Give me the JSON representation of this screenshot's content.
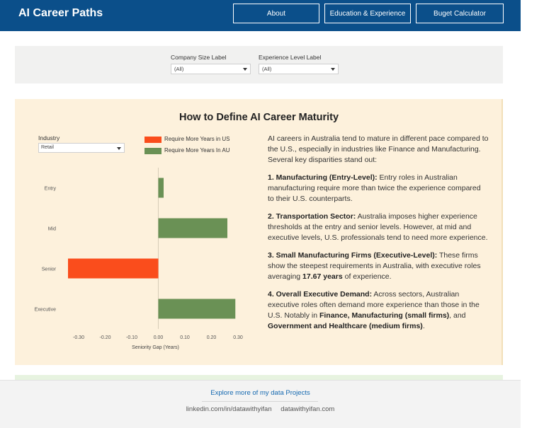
{
  "header": {
    "brand": "AI Career Paths",
    "nav": [
      "About",
      "Education & Experience",
      "Buget Calculator"
    ]
  },
  "filters": {
    "company_size": {
      "label": "Company Size Label",
      "value": "(All)"
    },
    "experience_level": {
      "label": "Experience Level Label",
      "value": "(All)"
    }
  },
  "panel": {
    "title": "How to Define AI Career Maturity",
    "industry": {
      "label": "Industry",
      "value": "Retail"
    },
    "legend": [
      {
        "label": "Require More Years in US",
        "color": "#fa4d1c"
      },
      {
        "label": "Require More Years In AU",
        "color": "#6a9155"
      }
    ],
    "intro": "AI careers in Australia tend to mature in different pace compared to the U.S., especially in industries like Finance and Manufacturing. Several key disparities stand out:",
    "points": [
      {
        "head": "1. Manufacturing (Entry-Level):",
        "body": " Entry roles in Australian manufacturing require more than twice the experience compared to their U.S. counterparts."
      },
      {
        "head": "2. Transportation Sector:",
        "body": " Australia imposes higher experience thresholds at the entry and senior levels. However, at mid and executive levels, U.S. professionals tend to need more experience."
      },
      {
        "head": "3. Small Manufacturing Firms (Executive-Level):",
        "body_pre": " These firms show the steepest requirements in Australia, with executive roles averaging ",
        "bold": "17.67 years",
        "body_post": " of experience."
      },
      {
        "head": "4. Overall Executive Demand:",
        "body_pre": " Across sectors, Australian executive roles often demand more experience than those in the U.S. Notably in ",
        "bold1": "Finance, Manufacturing (small firms)",
        "mid": ", and ",
        "bold2": "Government and Healthcare (medium firms)",
        "end": "."
      }
    ]
  },
  "chart_data": {
    "type": "bar",
    "orientation": "horizontal",
    "categories": [
      "Entry",
      "Mid",
      "Senior",
      "Executive"
    ],
    "values": [
      0.02,
      0.26,
      -0.34,
      0.29
    ],
    "xlabel": "Seniority Gap (Years)",
    "xlim": [
      -0.34,
      0.3
    ],
    "xticks": [
      -0.3,
      -0.2,
      -0.1,
      0.0,
      0.1,
      0.2,
      0.3
    ],
    "xtick_labels": [
      "-0.30",
      "-0.20",
      "-0.10",
      "0.00",
      "0.10",
      "0.20",
      "0.30"
    ],
    "negative_color": "#fa4d1c",
    "positive_color": "#6a9155"
  },
  "footer": {
    "link": "Explore more of my data Projects",
    "links": [
      "linkedin.com/in/datawithyifan",
      "datawithyifan.com"
    ]
  }
}
